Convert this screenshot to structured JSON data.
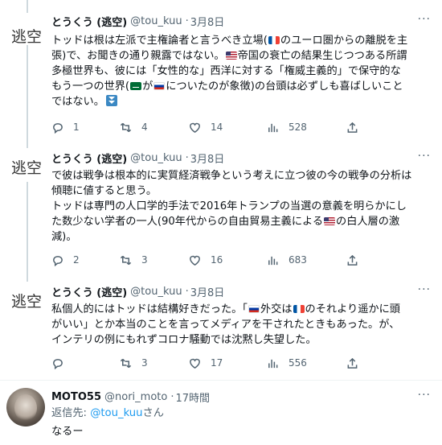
{
  "tweets": [
    {
      "avatar_text": "逃空",
      "name": "とうくう (逃空)",
      "handle": "@tou_kuu",
      "dot": "·",
      "time": "3月8日",
      "more": "···",
      "lines": [
        [
          "トッドは根は左派で主権論者と言うべき立場(",
          "flag-fr",
          "のユーロ圏からの離脱を主"
        ],
        [
          "張)で、お聞きの通り親露ではない。",
          "flag-us",
          "帝国の衰亡の結果生じつつある所謂"
        ],
        [
          "多極世界も、彼には「女性的な」西洋に対する「権威主義的」で保守的な"
        ],
        [
          "もう一つの世界(",
          "flag-sa",
          "が",
          "flag-ru",
          "についたのが象徴)の台頭は必ずしも喜ばしいこと"
        ],
        [
          "ではない。",
          "emoji-down"
        ]
      ],
      "reply_count": "1",
      "retweet_count": "4",
      "like_count": "14",
      "view_count": "528"
    },
    {
      "avatar_text": "逃空",
      "name": "とうくう (逃空)",
      "handle": "@tou_kuu",
      "dot": "·",
      "time": "3月8日",
      "more": "···",
      "lines": [
        [
          "で彼は戦争は根本的に実質経済戦争という考えに立つ彼の今の戦争の分析は"
        ],
        [
          "傾聴に値すると思う。"
        ],
        [
          "トッドは専門の人口学的手法で2016年トランプの当選の意義を明らかにし"
        ],
        [
          "た数少ない学者の一人(90年代からの自由貿易主義による",
          "flag-us",
          "の白人層の激"
        ],
        [
          "減)。"
        ]
      ],
      "reply_count": "2",
      "retweet_count": "3",
      "like_count": "16",
      "view_count": "683"
    },
    {
      "avatar_text": "逃空",
      "name": "とうくう (逃空)",
      "handle": "@tou_kuu",
      "dot": "·",
      "time": "3月8日",
      "more": "···",
      "lines": [
        [
          "私個人的にはトッドは結構好きだった。「",
          "flag-ru",
          "外交は",
          "flag-fr",
          "のそれより遥かに頭"
        ],
        [
          "がいい」とか本当のことを言ってメディアを干されたときもあった。が、"
        ],
        [
          "インテリの例にもれずコロナ騒動では沈黙し失望した。"
        ]
      ],
      "reply_count": "",
      "retweet_count": "3",
      "like_count": "17",
      "view_count": "556"
    }
  ],
  "reply": {
    "name": "MOTO55",
    "handle": "@nori_moto",
    "dot": "·",
    "time": "17時間",
    "more": "···",
    "replying_prefix": "返信先: ",
    "replying_handle": "@tou_kuu",
    "replying_suffix": "さん",
    "text": "なるー"
  },
  "icons": [
    "reply-icon",
    "retweet-icon",
    "like-icon",
    "views-icon",
    "share-icon",
    "more-icon"
  ],
  "colors": {
    "link": "#1d9bf0",
    "muted": "#536471",
    "divider": "#eff3f4"
  }
}
